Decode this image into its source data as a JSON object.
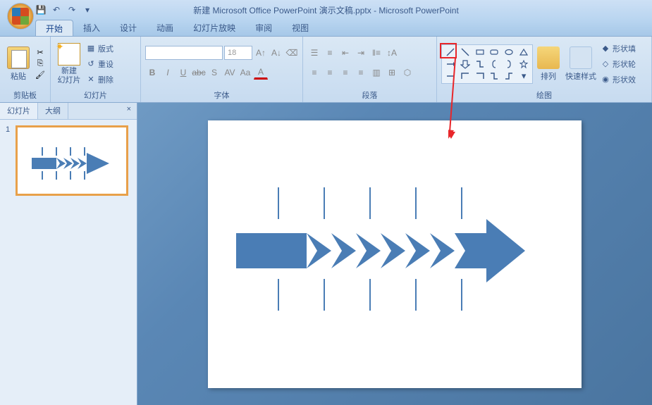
{
  "title": "新建 Microsoft Office PowerPoint 演示文稿.pptx - Microsoft PowerPoint",
  "tabs": {
    "home": "开始",
    "insert": "插入",
    "design": "设计",
    "anim": "动画",
    "slideshow": "幻灯片放映",
    "review": "审阅",
    "view": "视图"
  },
  "groups": {
    "clipboard": "剪贴板",
    "slides": "幻灯片",
    "font": "字体",
    "paragraph": "段落",
    "drawing": "绘图"
  },
  "buttons": {
    "paste": "粘贴",
    "newslide": "新建\n幻灯片",
    "layout": "版式",
    "reset": "重设",
    "delete": "删除",
    "arrange": "排列",
    "quickstyles": "快速样式",
    "shapefill": "形状填",
    "shapeoutline": "形状轮",
    "shapeeffects": "形状效"
  },
  "font": {
    "family_placeholder": "",
    "size": "18"
  },
  "panel": {
    "slides_tab": "幻灯片",
    "outline_tab": "大纲",
    "close": "×"
  },
  "slide_number": "1"
}
